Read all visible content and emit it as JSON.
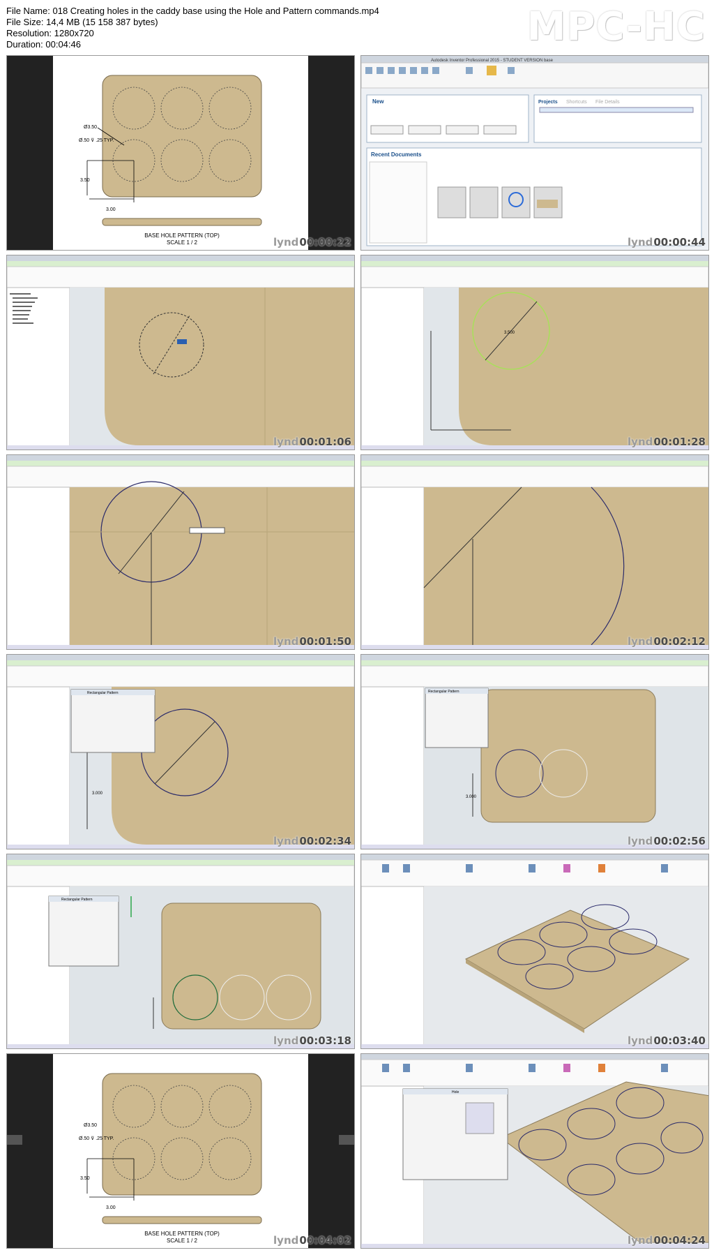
{
  "header": {
    "file_name_label": "File Name:",
    "file_name": "018 Creating holes in the caddy base using the Hole and Pattern commands.mp4",
    "file_size_label": "File Size:",
    "file_size": "14,4 MB (15 158 387 bytes)",
    "resolution_label": "Resolution:",
    "resolution": "1280x720",
    "duration_label": "Duration:",
    "duration": "00:04:46",
    "brand": "MPC-HC"
  },
  "watermark": "lynd",
  "drawing": {
    "title": "BASE HOLE PATTERN (TOP)",
    "scale": "SCALE 1 / 2",
    "dim_dia": "Ø3.50",
    "dim_hole": "Ø.50 ⊽ .25 TYP.",
    "dim_v": "3.50",
    "dim_h": "3.00"
  },
  "inventor": {
    "title_bar": "Autodesk Inventor Professional 2015 - STUDENT VERSION   base",
    "new_heading": "New",
    "projects_tab": "Projects",
    "shortcuts_tab": "Shortcuts",
    "file_details_tab": "File Details",
    "recent_heading": "Recent Documents",
    "pattern_dialog": "Rectangular Pattern",
    "hole_dialog": "Hole",
    "dim_350": "3.500",
    "dim_300": "3.000"
  },
  "thumbnails": [
    {
      "time": "00:00:22"
    },
    {
      "time": "00:00:44"
    },
    {
      "time": "00:01:06"
    },
    {
      "time": "00:01:28"
    },
    {
      "time": "00:01:50"
    },
    {
      "time": "00:02:12"
    },
    {
      "time": "00:02:34"
    },
    {
      "time": "00:02:56"
    },
    {
      "time": "00:03:18"
    },
    {
      "time": "00:03:40"
    },
    {
      "time": "00:04:02"
    },
    {
      "time": "00:04:24"
    }
  ],
  "colors": {
    "plate": "#cdb98f",
    "plate_edge": "#8b7b5a",
    "ribbon_green": "#d9efcf",
    "black_bar": "#222222"
  }
}
